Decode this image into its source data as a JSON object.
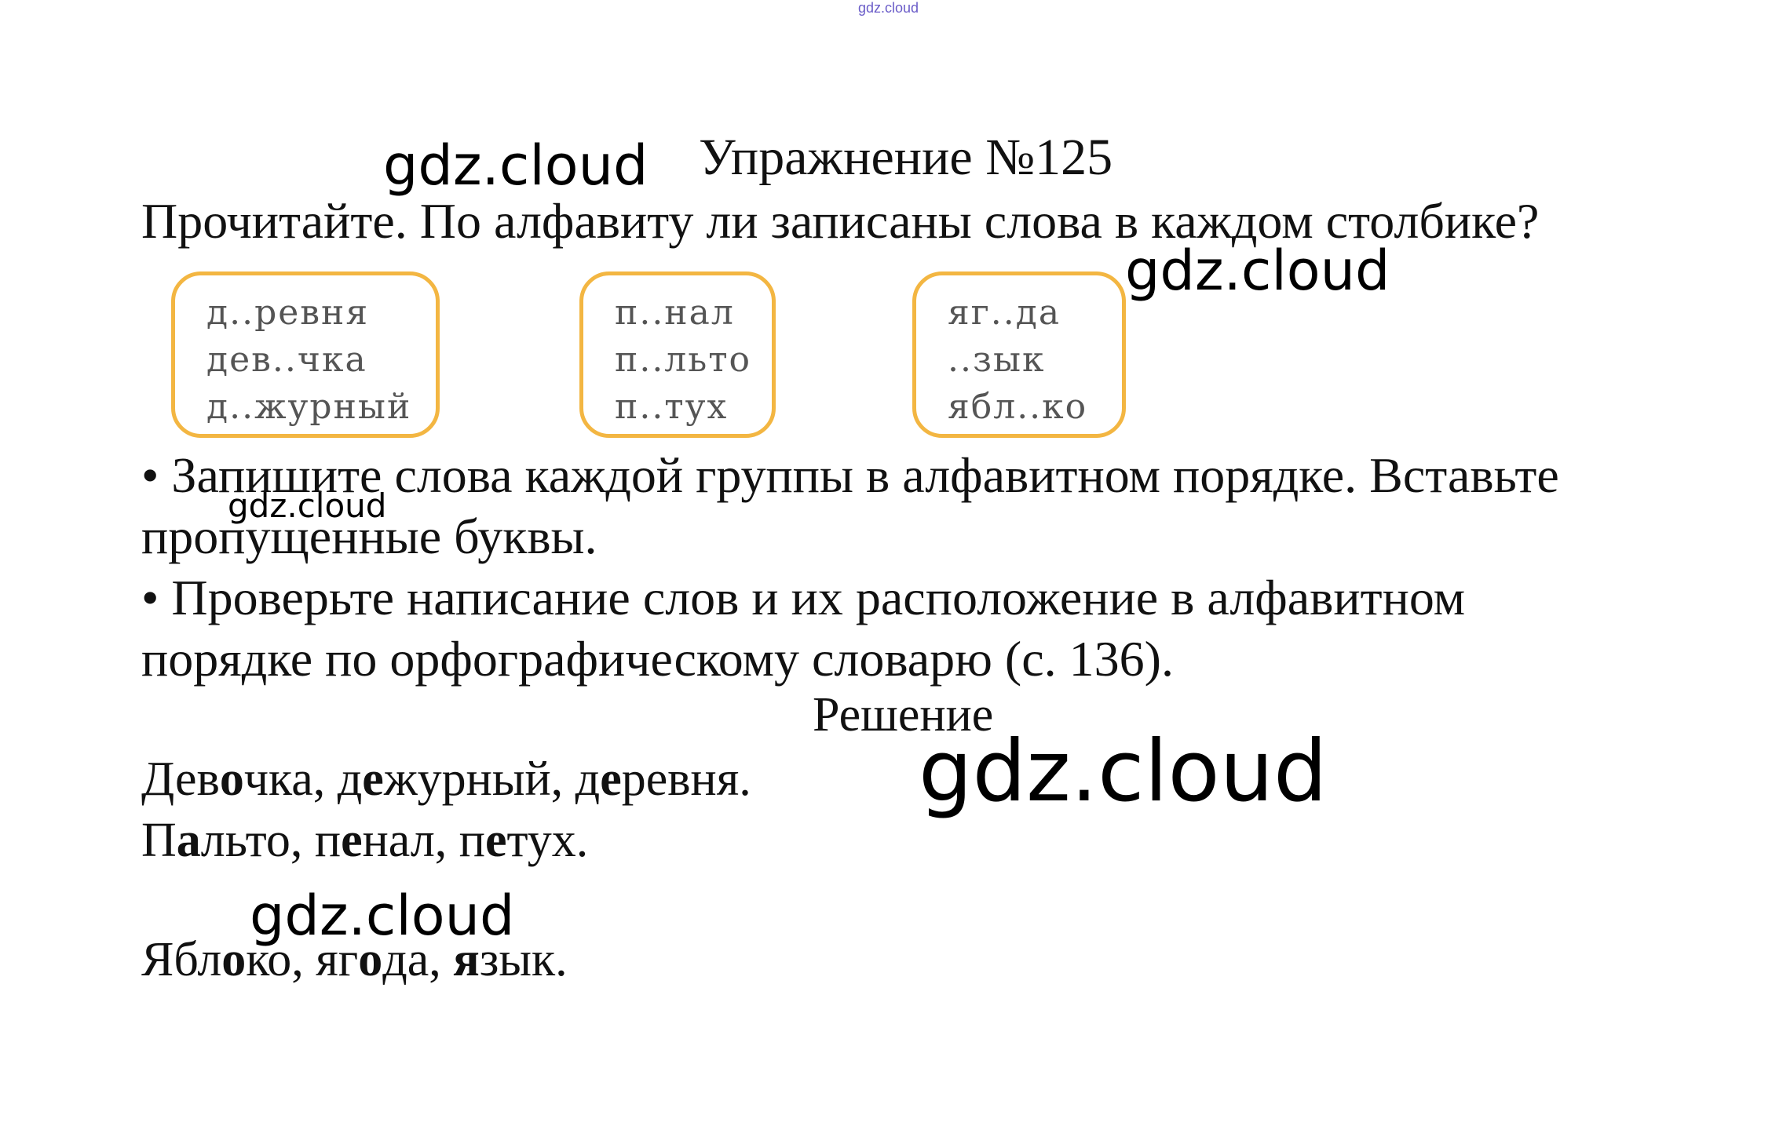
{
  "top_mark": "gdz.cloud",
  "watermark": "gdz.cloud",
  "title": "Упражнение №125",
  "task": {
    "question": "Прочитайте. По алфавиту ли записаны слова в каждом столбике?",
    "bullet1_line1": "• Запишите слова каждой группы в алфавитном порядке. Вставьте",
    "bullet1_line2": "пропущенные буквы.",
    "bullet2_line1": "• Проверьте написание слов и их расположение в алфавитном",
    "bullet2_line2": "порядке по орфографическому словарю (с. 136)."
  },
  "word_groups": [
    {
      "words": [
        "д..ревня",
        "дев..чка",
        "д..журный"
      ]
    },
    {
      "words": [
        "п..нал",
        "п..льто",
        "п..тух"
      ]
    },
    {
      "words": [
        "яг..да",
        "..зык",
        "ябл..ко"
      ]
    }
  ],
  "solution": {
    "heading": "Решение",
    "lines": [
      {
        "parts": [
          "Дев",
          "о",
          "чка, д",
          "е",
          "журный, д",
          "е",
          "ревня."
        ]
      },
      {
        "parts": [
          "П",
          "а",
          "льто, п",
          "е",
          "нал, п",
          "е",
          "тух."
        ]
      },
      {
        "parts": [
          "Ябл",
          "о",
          "ко, яг",
          "о",
          "да, ",
          "я",
          "зык."
        ]
      }
    ]
  },
  "colors": {
    "box_border": "#f3b642",
    "top_mark": "#6a5cc8"
  }
}
